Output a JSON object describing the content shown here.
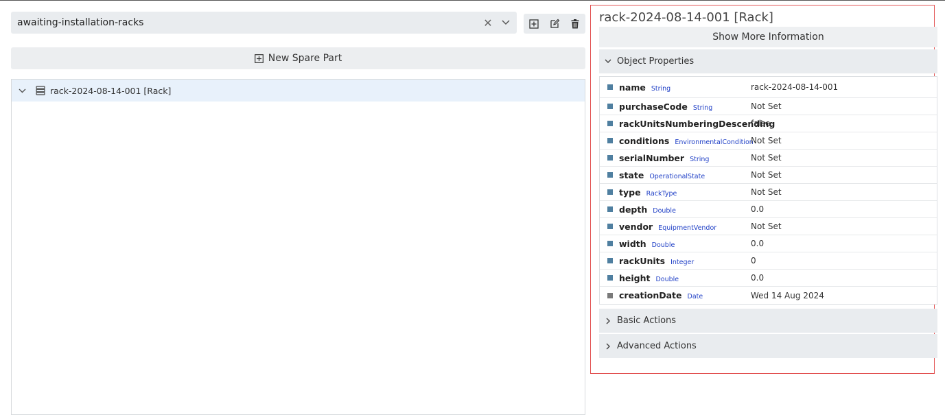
{
  "pool_selector": {
    "value": "awaiting-installation-racks",
    "clear_icon": "close-icon",
    "dropdown_icon": "chevron-down-icon"
  },
  "toolbar": {
    "buttons": [
      {
        "icon": "add-icon"
      },
      {
        "icon": "edit-icon"
      },
      {
        "icon": "trash-icon"
      }
    ]
  },
  "new_spare_part": {
    "label": "New Spare Part",
    "icon": "plus-square-icon"
  },
  "tree": {
    "items": [
      {
        "label": "rack-2024-08-14-001 [Rack]",
        "icon": "rack-icon",
        "expanded": true
      }
    ]
  },
  "detail": {
    "title": "rack-2024-08-14-001 [Rack]",
    "show_more_label": "Show More Information",
    "object_properties_label": "Object Properties",
    "properties": [
      {
        "name": "name",
        "type": "String",
        "value": "rack-2024-08-14-001"
      },
      {
        "name": "purchaseCode",
        "type": "String",
        "value": "Not Set"
      },
      {
        "name": "rackUnitsNumberingDescending",
        "type": "",
        "value": "false"
      },
      {
        "name": "conditions",
        "type": "EnvironmentalCondition",
        "value": "Not Set"
      },
      {
        "name": "serialNumber",
        "type": "String",
        "value": "Not Set"
      },
      {
        "name": "state",
        "type": "OperationalState",
        "value": "Not Set"
      },
      {
        "name": "type",
        "type": "RackType",
        "value": "Not Set"
      },
      {
        "name": "depth",
        "type": "Double",
        "value": "0.0"
      },
      {
        "name": "vendor",
        "type": "EquipmentVendor",
        "value": "Not Set"
      },
      {
        "name": "width",
        "type": "Double",
        "value": "0.0"
      },
      {
        "name": "rackUnits",
        "type": "Integer",
        "value": "0"
      },
      {
        "name": "height",
        "type": "Double",
        "value": "0.0"
      },
      {
        "name": "creationDate",
        "type": "Date",
        "value": "Wed 14 Aug 2024"
      }
    ],
    "basic_actions_label": "Basic Actions",
    "advanced_actions_label": "Advanced Actions"
  },
  "colors": {
    "selection_border": "#e25252",
    "type_label": "#1f3fc6",
    "tree_selected": "#e8f1fb"
  }
}
